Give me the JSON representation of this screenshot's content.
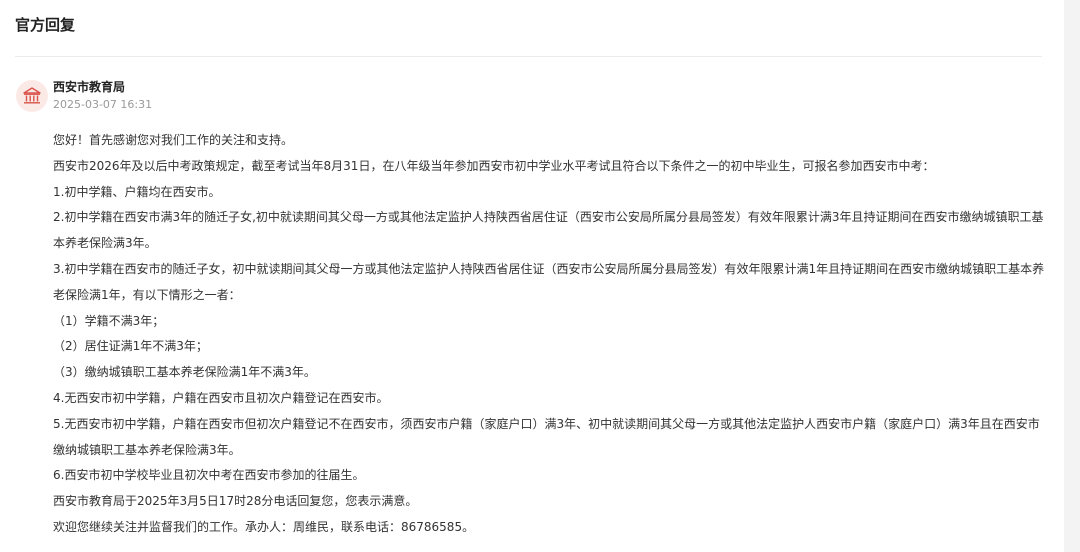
{
  "section": {
    "title": "官方回复"
  },
  "reply": {
    "icon": "government-building-icon",
    "org_name": "西安市教育局",
    "timestamp": "2025-03-07 16:31",
    "paragraphs": [
      "您好！首先感谢您对我们工作的关注和支持。",
      "西安市2026年及以后中考政策规定，截至考试当年8月31日，在八年级当年参加西安市初中学业水平考试且符合以下条件之一的初中毕业生，可报名参加西安市中考：",
      "1.初中学籍、户籍均在西安市。",
      "2.初中学籍在西安市满3年的随迁子女,初中就读期间其父母一方或其他法定监护人持陕西省居住证（西安市公安局所属分县局签发）有效年限累计满3年且持证期间在西安市缴纳城镇职工基本养老保险满3年。",
      "3.初中学籍在西安市的随迁子女，初中就读期间其父母一方或其他法定监护人持陕西省居住证（西安市公安局所属分县局签发）有效年限累计满1年且持证期间在西安市缴纳城镇职工基本养老保险满1年，有以下情形之一者：",
      "（1）学籍不满3年；",
      "（2）居住证满1年不满3年；",
      "（3）缴纳城镇职工基本养老保险满1年不满3年。",
      "4.无西安市初中学籍，户籍在西安市且初次户籍登记在西安市。",
      "5.无西安市初中学籍，户籍在西安市但初次户籍登记不在西安市，须西安市户籍（家庭户口）满3年、初中就读期间其父母一方或其他法定监护人西安市户籍（家庭户口）满3年且在西安市缴纳城镇职工基本养老保险满3年。",
      "6.西安市初中学校毕业且初次中考在西安市参加的往届生。",
      "西安市教育局于2025年3月5日17时28分电话回复您，您表示满意。",
      "欢迎您继续关注并监督我们的工作。承办人：周维民，联系电话：86786585。"
    ]
  },
  "colors": {
    "title": "#222222",
    "body_text": "#333333",
    "meta_text": "#999999",
    "divider": "#ececec",
    "avatar_bg": "#fbe9e6",
    "avatar_icon": "#d9534a"
  }
}
